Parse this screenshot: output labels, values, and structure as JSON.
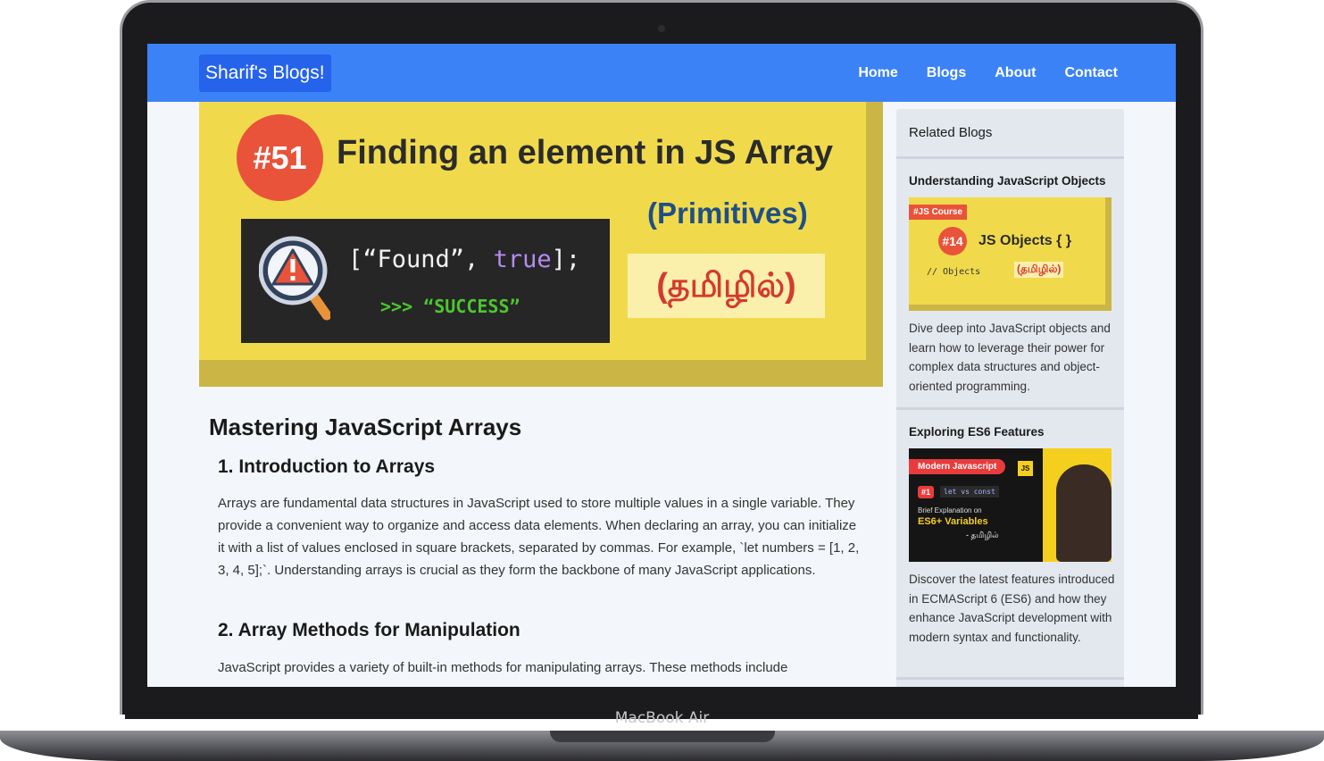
{
  "device": {
    "label": "MacBook Air"
  },
  "navbar": {
    "logo": "Sharif's Blogs!",
    "links": [
      {
        "label": "Home"
      },
      {
        "label": "Blogs"
      },
      {
        "label": "About"
      },
      {
        "label": "Contact"
      }
    ]
  },
  "hero": {
    "number": "#51",
    "title": "Finding an element in JS Array",
    "code_open": "[“Found”, ",
    "code_keyword": "true",
    "code_close": "];",
    "code_result": ">>> “SUCCESS”",
    "subtitle": "(Primitives)",
    "tamil": "(தமிழில்)"
  },
  "article": {
    "title": "Mastering JavaScript Arrays",
    "sections": [
      {
        "heading": "1. Introduction to Arrays",
        "text": "Arrays are fundamental data structures in JavaScript used to store multiple values in a single variable. They provide a convenient way to organize and access data elements. When declaring an array, you can initialize it with a list of values enclosed in square brackets, separated by commas. For example, `let numbers = [1, 2, 3, 4, 5];`. Understanding arrays is crucial as they form the backbone of many JavaScript applications."
      },
      {
        "heading": "2. Array Methods for Manipulation",
        "text": "JavaScript provides a variety of built-in methods for manipulating arrays. These methods include"
      }
    ]
  },
  "sidebar": {
    "title": "Related Blogs",
    "cards": [
      {
        "title": "Understanding JavaScript Objects",
        "description": "Dive deep into JavaScript objects and learn how to leverage their power for complex data structures and object-oriented programming.",
        "thumb": {
          "tag": "#JS Course",
          "number": "#14",
          "heading": "JS Objects { }",
          "code": "// Objects",
          "tamil": "(தமிழில்)"
        }
      },
      {
        "title": "Exploring ES6 Features",
        "description": "Discover the latest features introduced in ECMAScript 6 (ES6) and how they enhance JavaScript development with modern syntax and functionality.",
        "thumb": {
          "tag": "Modern Javascript",
          "js": "JS",
          "number": "#1",
          "code": "let vs const",
          "sub": "Brief Explanation on",
          "main": "ES6+ Variables",
          "tamil": "- தமிழில்"
        }
      }
    ]
  },
  "colors": {
    "navbar": "#3b82f6",
    "logo_bg": "#2563eb",
    "hero_yellow": "#f0da4c",
    "accent_red": "#e9533a"
  }
}
